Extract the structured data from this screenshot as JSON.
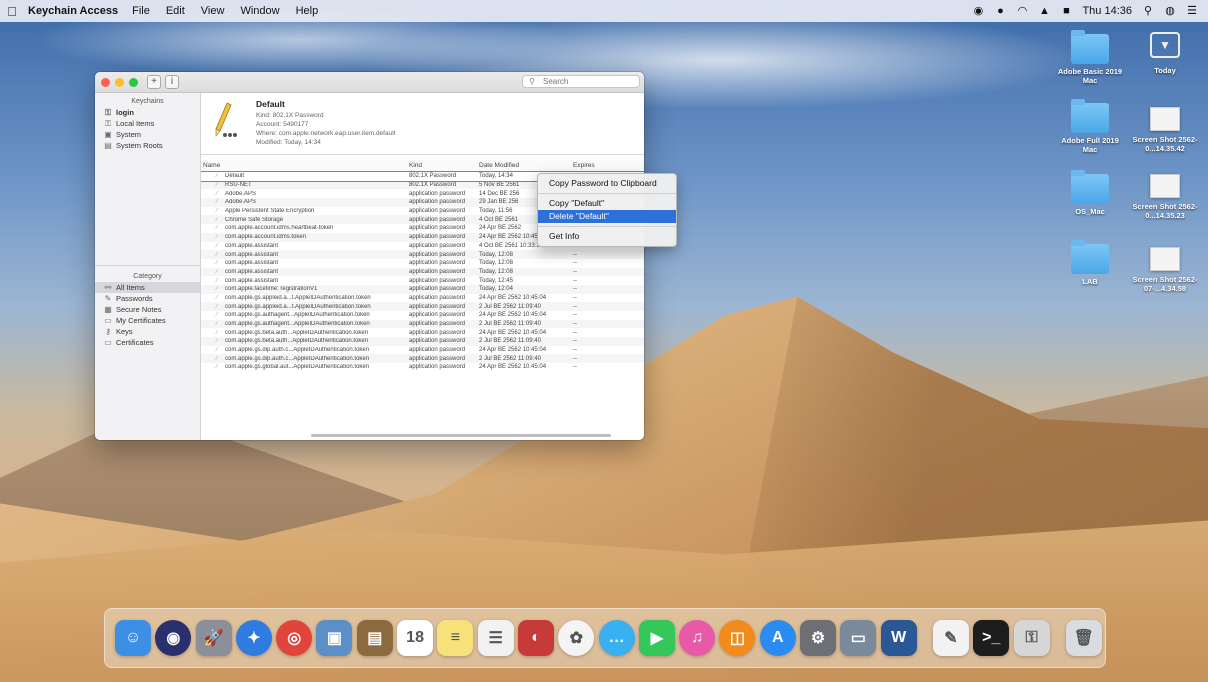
{
  "menubar": {
    "app_name": "Keychain Access",
    "menus": [
      "File",
      "Edit",
      "View",
      "Window",
      "Help"
    ],
    "clock": "Thu 14:36"
  },
  "window": {
    "search_placeholder": "Search",
    "sidebar": {
      "keychains_heading": "Keychains",
      "keychains": [
        "login",
        "Local Items",
        "System",
        "System Roots"
      ],
      "category_heading": "Category",
      "categories": [
        "All Items",
        "Passwords",
        "Secure Notes",
        "My Certificates",
        "Keys",
        "Certificates"
      ]
    },
    "detail": {
      "title": "Default",
      "kind": "Kind: 802.1X Password",
      "account": "Account: 5490177",
      "where": "Where: com.apple.network.eap.user.item.default",
      "modified": "Modified: Today, 14:34"
    },
    "columns": {
      "name": "Name",
      "kind": "Kind",
      "date": "Date Modified",
      "expires": "Expires"
    },
    "rows": [
      {
        "name": "Default",
        "kind": "802.1X Password",
        "date": "Today, 14:34",
        "expires": ""
      },
      {
        "name": "RSU-NET",
        "kind": "802.1X Password",
        "date": "5 Nov BE 2561",
        "expires": ""
      },
      {
        "name": "Adobe.APS",
        "kind": "application password",
        "date": "14 Dec BE 256",
        "expires": ""
      },
      {
        "name": "Adobe.APS",
        "kind": "application password",
        "date": "29 Jan BE 256",
        "expires": ""
      },
      {
        "name": "Apple Persistent State Encryption",
        "kind": "application password",
        "date": "Today, 11:56",
        "expires": ""
      },
      {
        "name": "Chrome Safe Storage",
        "kind": "application password",
        "date": "4 Oct BE 2561",
        "expires": ""
      },
      {
        "name": "com.apple.account.idms.heartbeat-token",
        "kind": "application password",
        "date": "24 Apr BE 2562",
        "expires": "--"
      },
      {
        "name": "com.apple.account.idms.token",
        "kind": "application password",
        "date": "24 Apr BE 2562 10:45:04",
        "expires": "--"
      },
      {
        "name": "com.apple.assistant",
        "kind": "application password",
        "date": "4 Oct BE 2561 10:33:37",
        "expires": "--"
      },
      {
        "name": "com.apple.assistant",
        "kind": "application password",
        "date": "Today, 12:08",
        "expires": "--"
      },
      {
        "name": "com.apple.assistant",
        "kind": "application password",
        "date": "Today, 12:08",
        "expires": "--"
      },
      {
        "name": "com.apple.assistant",
        "kind": "application password",
        "date": "Today, 12:08",
        "expires": "--"
      },
      {
        "name": "com.apple.assistant",
        "kind": "application password",
        "date": "Today, 12:45",
        "expires": "--"
      },
      {
        "name": "com.apple.facetime: registrationV1",
        "kind": "application password",
        "date": "Today, 12:04",
        "expires": "--"
      },
      {
        "name": "com.apple.gs.appleid.a...t.AppleIDAuthentication.token",
        "kind": "application password",
        "date": "24 Apr BE 2562 10:45:04",
        "expires": "--"
      },
      {
        "name": "com.apple.gs.appleid.a...t.AppleIDAuthentication.token",
        "kind": "application password",
        "date": "2 Jul BE 2562 11:09:40",
        "expires": "--"
      },
      {
        "name": "com.apple.gs.authagent...AppleIDAuthentication.token",
        "kind": "application password",
        "date": "24 Apr BE 2562 10:45:04",
        "expires": "--"
      },
      {
        "name": "com.apple.gs.authagent...AppleIDAuthentication.token",
        "kind": "application password",
        "date": "2 Jul BE 2562 11:09:40",
        "expires": "--"
      },
      {
        "name": "com.apple.gs.beta.auth...AppleIDAuthentication.token",
        "kind": "application password",
        "date": "24 Apr BE 2562 10:45:04",
        "expires": "--"
      },
      {
        "name": "com.apple.gs.beta.auth...AppleIDAuthentication.token",
        "kind": "application password",
        "date": "2 Jul BE 2562 11:09:40",
        "expires": "--"
      },
      {
        "name": "com.apple.gs.dip.auth.c...AppleIDAuthentication.token",
        "kind": "application password",
        "date": "24 Apr BE 2562 10:45:04",
        "expires": "--"
      },
      {
        "name": "com.apple.gs.dip.auth.c...AppleIDAuthentication.token",
        "kind": "application password",
        "date": "2 Jul BE 2562 11:09:40",
        "expires": "--"
      },
      {
        "name": "com.apple.gs.global.aut...AppleIDAuthentication.token",
        "kind": "application password",
        "date": "24 Apr BE 2562 10:45:04",
        "expires": "--"
      }
    ]
  },
  "context_menu": {
    "copy_password": "Copy Password to Clipboard",
    "copy_item": "Copy \"Default\"",
    "delete_item": "Delete \"Default\"",
    "get_info": "Get Info"
  },
  "desktop_icons": [
    {
      "label": "Adobe Basic 2019 Mac",
      "icon": "folder-icon"
    },
    {
      "label": "Today",
      "icon": "folder-download-icon"
    },
    {
      "label": "Adobe Full 2019 Mac",
      "icon": "folder-icon"
    },
    {
      "label": "Screen Shot 2562-0...14.35.42",
      "icon": "screenshot-icon"
    },
    {
      "label": "OS_Mac",
      "icon": "folder-icon"
    },
    {
      "label": "Screen Shot 2562-0...14.35.23",
      "icon": "screenshot-icon"
    },
    {
      "label": "LAB",
      "icon": "folder-icon"
    },
    {
      "label": "Screen Shot 2562-07-...4.34.58",
      "icon": "screenshot-icon"
    }
  ],
  "dock": {
    "apps": [
      {
        "name": "finder-icon",
        "color": "#3d8fe6",
        "glyph": "☺"
      },
      {
        "name": "siri-icon",
        "color": "#2a2f6e",
        "glyph": "◉"
      },
      {
        "name": "launchpad-icon",
        "color": "#8a8f99",
        "glyph": "🚀"
      },
      {
        "name": "safari-icon",
        "color": "#2f7be0",
        "glyph": "✦"
      },
      {
        "name": "chrome-icon",
        "color": "#e0443a",
        "glyph": "◎"
      },
      {
        "name": "preview-icon",
        "color": "#5b8fc8",
        "glyph": "▣"
      },
      {
        "name": "notes-book-icon",
        "color": "#8b6a3e",
        "glyph": "▤"
      },
      {
        "name": "calendar-icon",
        "color": "#ffffff",
        "glyph": "18"
      },
      {
        "name": "notes-icon",
        "color": "#f7e17a",
        "glyph": "≡"
      },
      {
        "name": "reminders-icon",
        "color": "#f2f2f2",
        "glyph": "☰"
      },
      {
        "name": "photo-booth-icon",
        "color": "#c73a3a",
        "glyph": "◐"
      },
      {
        "name": "photos-icon",
        "color": "#f4f4f4",
        "glyph": "✿"
      },
      {
        "name": "messages-icon",
        "color": "#3ab0f0",
        "glyph": "…"
      },
      {
        "name": "facetime-icon",
        "color": "#34c759",
        "glyph": "▶"
      },
      {
        "name": "itunes-icon",
        "color": "#e85aa8",
        "glyph": "♫"
      },
      {
        "name": "books-icon",
        "color": "#f28a1c",
        "glyph": "◫"
      },
      {
        "name": "app-store-icon",
        "color": "#2a8bf0",
        "glyph": "A"
      },
      {
        "name": "system-preferences-icon",
        "color": "#6d6f75",
        "glyph": "⚙"
      },
      {
        "name": "image-capture-icon",
        "color": "#7a8a9a",
        "glyph": "▭"
      },
      {
        "name": "word-icon",
        "color": "#2b5797",
        "glyph": "W"
      },
      {
        "name": "textedit-icon",
        "color": "#f2f2f2",
        "glyph": "✎"
      },
      {
        "name": "terminal-icon",
        "color": "#1d1d1d",
        "glyph": ">_"
      },
      {
        "name": "keychain-access-icon",
        "color": "#d6d6d6",
        "glyph": "⚿"
      },
      {
        "name": "trash-icon",
        "color": "#d9dde2",
        "glyph": "🗑"
      }
    ]
  }
}
